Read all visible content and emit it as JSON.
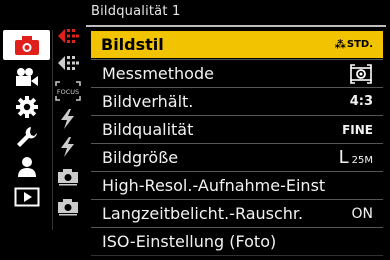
{
  "header": {
    "title": "Bildqualität 1"
  },
  "categories": [
    {
      "name": "photo",
      "icon": "camera-icon",
      "active": true
    },
    {
      "name": "video",
      "icon": "video-camera-icon",
      "active": false
    },
    {
      "name": "setup",
      "icon": "gear-icon",
      "active": false
    },
    {
      "name": "custom",
      "icon": "wrench-icon",
      "active": false
    },
    {
      "name": "my-menu",
      "icon": "person-icon",
      "active": false
    },
    {
      "name": "playback",
      "icon": "playback-icon",
      "active": false
    }
  ],
  "subtabs": [
    {
      "icon": "image-quality-icon",
      "active": true
    },
    {
      "icon": "image-quality-icon",
      "active": false
    },
    {
      "icon": "focus-icon",
      "label": "FOCUS",
      "active": false
    },
    {
      "icon": "flash-icon",
      "active": false
    },
    {
      "icon": "flash-icon",
      "active": false
    },
    {
      "icon": "camera-small-icon",
      "active": false
    },
    {
      "icon": "camera-small-icon",
      "active": false
    }
  ],
  "menu": {
    "items": [
      {
        "label": "Bildstil",
        "value": "STD.",
        "value_prefix": "⁂",
        "selected": true
      },
      {
        "label": "Messmethode",
        "value": "[◎]",
        "selected": false
      },
      {
        "label": "Bildverhält.",
        "value": "4:3",
        "selected": false
      },
      {
        "label": "Bildqualität",
        "value": "FINE",
        "selected": false
      },
      {
        "label": "Bildgröße",
        "value": "L",
        "value_sub": "25M",
        "selected": false
      },
      {
        "label": "High-Resol.-Aufnahme-Einst",
        "value": "",
        "selected": false
      },
      {
        "label": "Langzeitbelicht.-Rauschr.",
        "value": "ON",
        "selected": false
      },
      {
        "label": "ISO-Einstellung (Foto)",
        "value": "",
        "selected": false
      }
    ]
  },
  "colors": {
    "highlight": "#f2c300",
    "accent_red": "#e0201b",
    "text": "#ffffff"
  }
}
